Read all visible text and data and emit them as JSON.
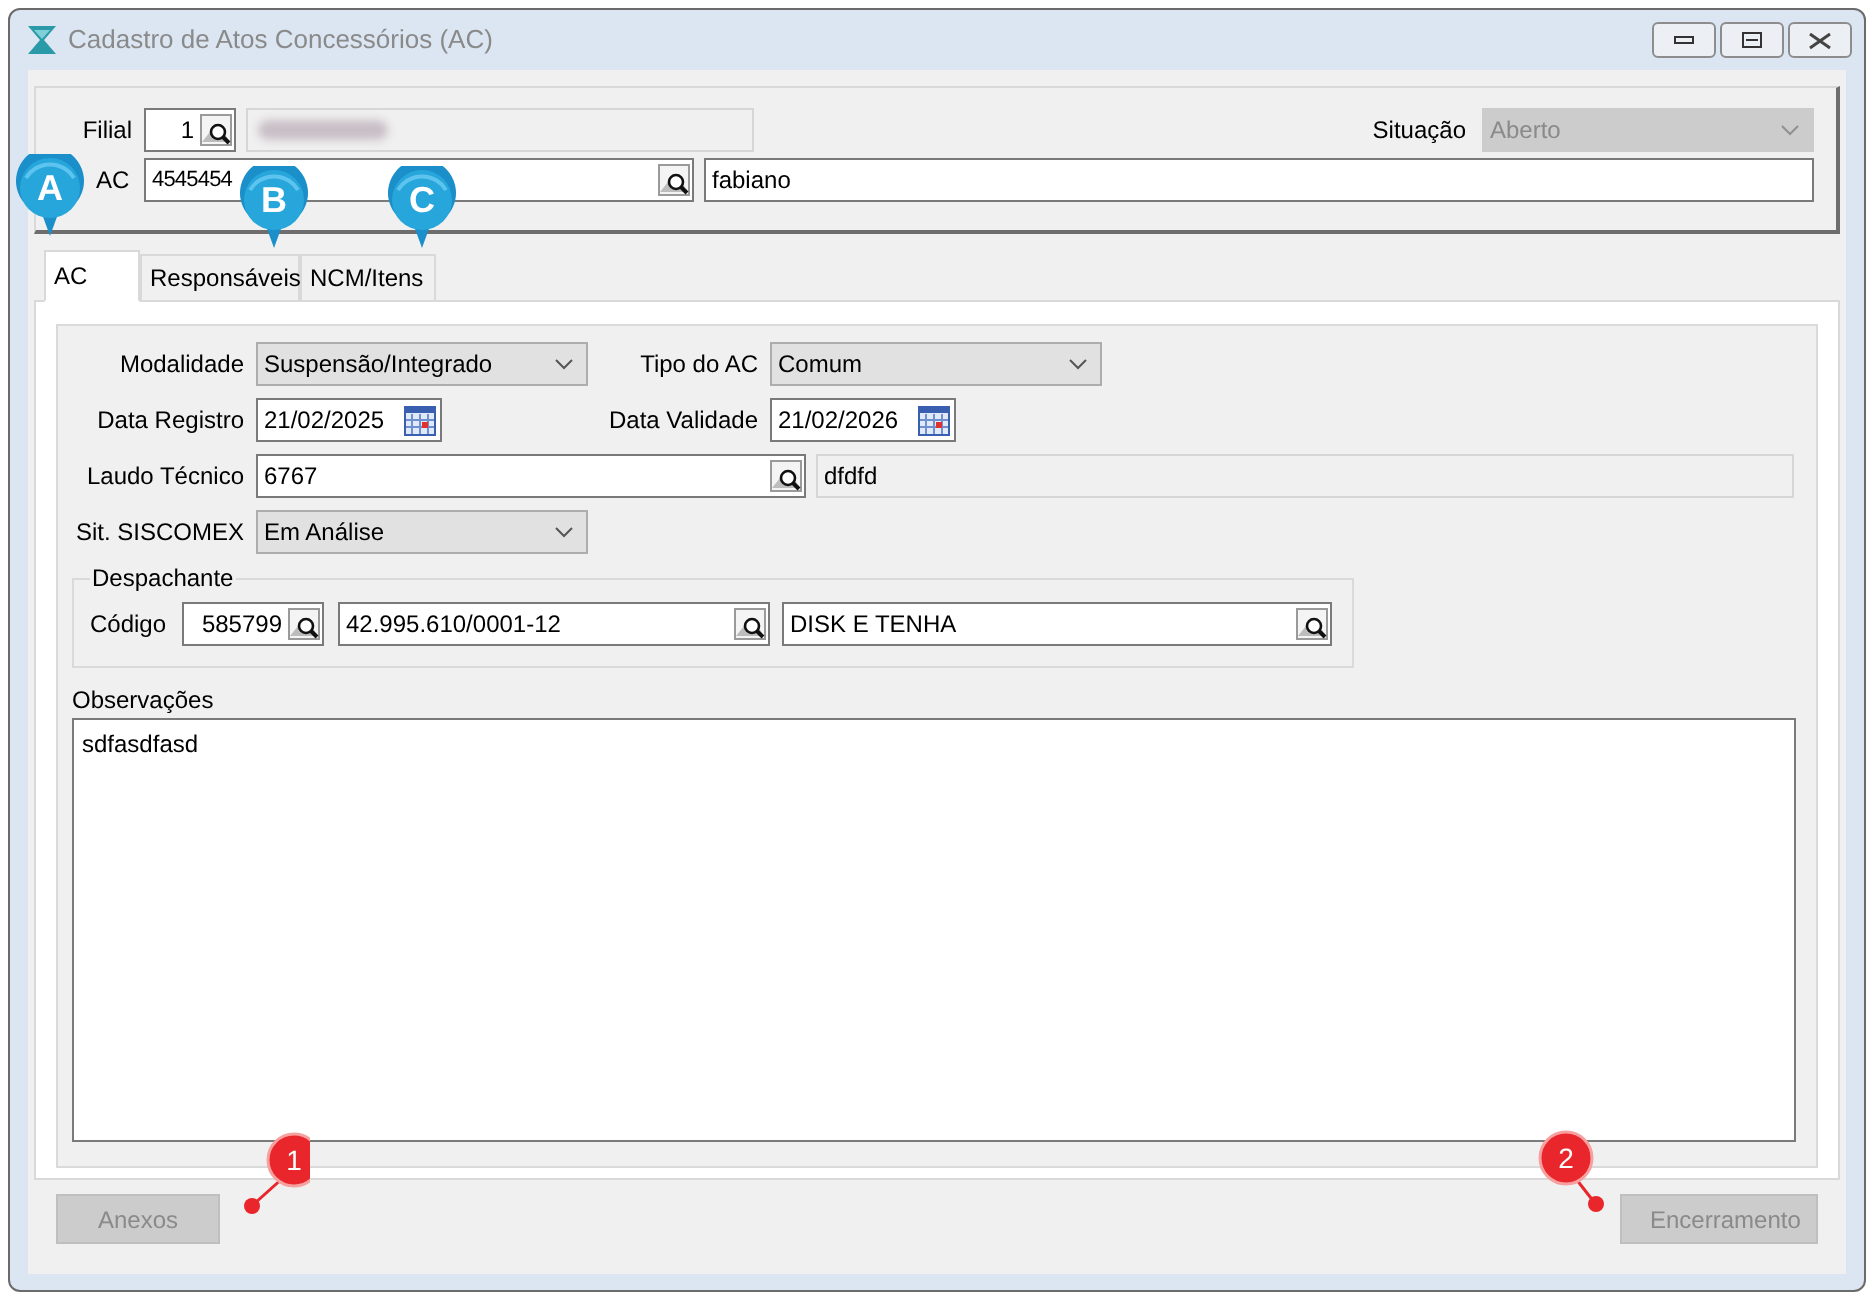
{
  "window": {
    "title": "Cadastro de Atos Concessórios (AC)"
  },
  "header": {
    "filial": {
      "label": "Filial",
      "value": "1"
    },
    "situacao": {
      "label": "Situação",
      "value": "Aberto",
      "disabled": true
    },
    "ac": {
      "label": "AC",
      "value": "4545454",
      "description": "fabiano"
    }
  },
  "tabs": [
    {
      "label": "AC",
      "selected": true
    },
    {
      "label": "Responsáveis",
      "selected": false
    },
    {
      "label": "NCM/Itens",
      "selected": false
    }
  ],
  "form": {
    "modalidade": {
      "label": "Modalidade",
      "value": "Suspensão/Integrado"
    },
    "tipo_ac": {
      "label": "Tipo do AC",
      "value": "Comum"
    },
    "data_registro": {
      "label": "Data Registro",
      "value": "21/02/2025"
    },
    "data_validade": {
      "label": "Data Validade",
      "value": "21/02/2026"
    },
    "laudo_tecnico": {
      "label": "Laudo Técnico",
      "value": "6767",
      "description": "dfdfd"
    },
    "sit_siscomex": {
      "label": "Sit. SISCOMEX",
      "value": "Em Análise"
    },
    "despachante": {
      "legend": "Despachante",
      "label": "Código",
      "codigo": "585799",
      "cnpj": "42.995.610/0001-12",
      "nome": "DISK E TENHA"
    },
    "observacoes": {
      "label": "Observações",
      "value": "sdfasdfasd"
    }
  },
  "buttons": [
    {
      "label": "Anexos",
      "disabled": true
    },
    {
      "label": "Encerramento",
      "disabled": true
    }
  ],
  "callouts": [
    {
      "kind": "pin",
      "label": "A"
    },
    {
      "kind": "pin",
      "label": "B"
    },
    {
      "kind": "pin",
      "label": "C"
    },
    {
      "kind": "marker",
      "label": "1"
    },
    {
      "kind": "marker",
      "label": "2"
    }
  ]
}
